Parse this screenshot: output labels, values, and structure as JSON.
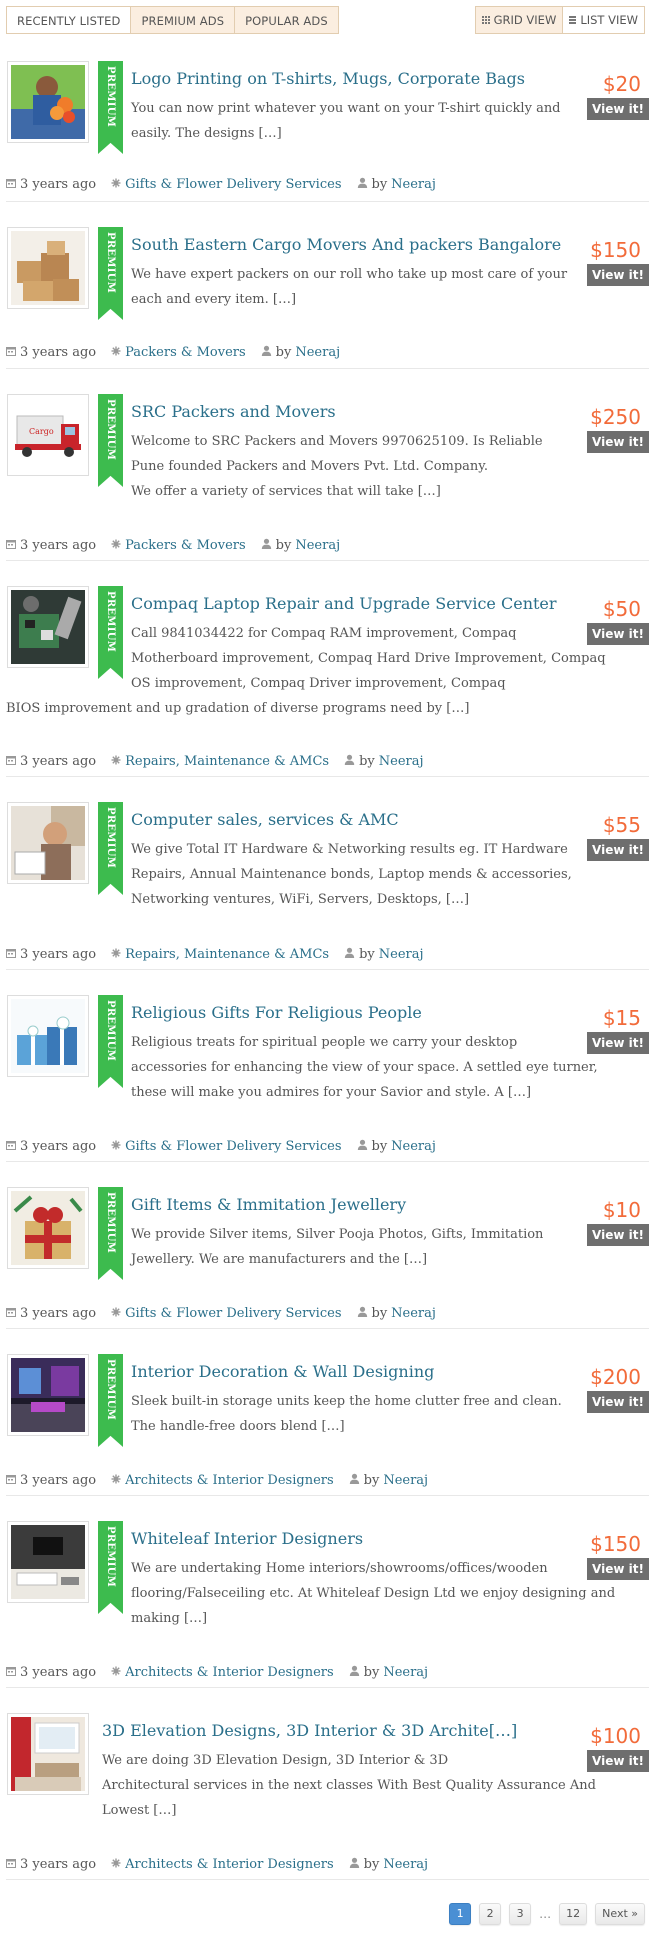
{
  "tabs": [
    {
      "label": "RECENTLY LISTED"
    },
    {
      "label": "PREMIUM ADS"
    },
    {
      "label": "POPULAR ADS"
    }
  ],
  "views": {
    "grid": "GRID VIEW",
    "list": "LIST VIEW"
  },
  "ribbon_label": "PREMIUM",
  "view_button": "View it!",
  "listings": [
    {
      "title": "Logo Printing on T-shirts, Mugs, Corporate Bags",
      "price": "$20",
      "desc_lines": [
        "You can now print whatever you want on your T-shirt quickly and",
        "easily. The designs […]"
      ],
      "time": "3 years ago",
      "category": "Gifts & Flower Delivery Services",
      "by": "by",
      "author": "Neeraj",
      "thumb_icon": "flowers-delivery-photo"
    },
    {
      "title": "South Eastern Cargo Movers And packers Bangalore",
      "price": "$150",
      "desc_lines": [
        "We have expert packers on our roll who take up most care of your",
        "each and every item. […]"
      ],
      "time": "3 years ago",
      "category": "Packers & Movers",
      "by": "by",
      "author": "Neeraj",
      "thumb_icon": "cardboard-boxes-photo"
    },
    {
      "title": "SRC Packers and Movers",
      "price": "$250",
      "desc_lines": [
        "Welcome to SRC Packers and Movers 9970625109. Is Reliable",
        "Pune founded Packers and Movers Pvt. Ltd. Company.",
        "We offer a variety of services that will take […]"
      ],
      "time": "3 years ago",
      "category": "Packers & Movers",
      "by": "by",
      "author": "Neeraj",
      "thumb_icon": "truck-photo"
    },
    {
      "title": "Compaq Laptop Repair and Upgrade Service Center",
      "price": "$50",
      "desc_lines": [
        "Call 9841034422 for Compaq RAM improvement, Compaq",
        "Motherboard improvement, Compaq Hard Drive Improvement, Compaq",
        "OS improvement, Compaq Driver improvement, Compaq",
        "BIOS improvement and up gradation of diverse programs need by […]"
      ],
      "time": "3 years ago",
      "category": "Repairs, Maintenance & AMCs",
      "by": "by",
      "author": "Neeraj",
      "thumb_icon": "circuit-repair-photo"
    },
    {
      "title": "Computer sales, services & AMC",
      "price": "$55",
      "desc_lines": [
        "We give Total IT Hardware & Networking results eg. IT Hardware",
        "Repairs, Annual Maintenance bonds, Laptop mends & accessories,",
        "Networking ventures, WiFi, Servers, Desktops, […]"
      ],
      "time": "3 years ago",
      "category": "Repairs, Maintenance & AMCs",
      "by": "by",
      "author": "Neeraj",
      "thumb_icon": "technician-photo"
    },
    {
      "title": "Religious Gifts For Religious People",
      "price": "$15",
      "desc_lines": [
        "Religious treats for spiritual people  we carry your desktop",
        "accessories for enhancing the view of your space. A settled eye turner,",
        "these will make you admires for your Savior and style. A […]"
      ],
      "time": "3 years ago",
      "category": "Gifts & Flower Delivery Services",
      "by": "by",
      "author": "Neeraj",
      "thumb_icon": "gift-boxes-photo"
    },
    {
      "title": "Gift Items & Immitation Jewellery",
      "price": "$10",
      "desc_lines": [
        "We provide Silver items, Silver Pooja Photos, Gifts, Immitation",
        "Jewellery. We are manufacturers and the […]"
      ],
      "time": "3 years ago",
      "category": "Gifts & Flower Delivery Services",
      "by": "by",
      "author": "Neeraj",
      "thumb_icon": "gift-ribbon-photo"
    },
    {
      "title": "Interior Decoration & Wall Designing",
      "price": "$200",
      "desc_lines": [
        "Sleek built-in storage units keep the home clutter free and clean.",
        "The handle-free doors blend […]"
      ],
      "time": "3 years ago",
      "category": "Architects & Interior Designers",
      "by": "by",
      "author": "Neeraj",
      "thumb_icon": "purple-interior-photo"
    },
    {
      "title": "Whiteleaf Interior Designers",
      "price": "$150",
      "desc_lines": [
        "We are undertaking Home interiors/showrooms/offices/wooden",
        "flooring/Falseceiling etc. At Whiteleaf Design Ltd we enjoy designing and",
        "making […]"
      ],
      "time": "3 years ago",
      "category": "Architects & Interior Designers",
      "by": "by",
      "author": "Neeraj",
      "thumb_icon": "living-room-photo"
    },
    {
      "title": "3D Elevation Designs, 3D Interior & 3D Archite[…]",
      "price": "$100",
      "desc_lines": [
        "We are doing 3D Elevation Design, 3D Interior & 3D",
        "Architectural services in the next classes With Best Quality Assurance And",
        "Lowest […]"
      ],
      "time": "3 years ago",
      "category": "Architects & Interior Designers",
      "by": "by",
      "author": "Neeraj",
      "thumb_icon": "3d-interior-photo"
    }
  ],
  "pagination": {
    "pages": [
      "1",
      "2",
      "3"
    ],
    "dots": "…",
    "last": "12",
    "next": "Next »",
    "current": "1"
  }
}
